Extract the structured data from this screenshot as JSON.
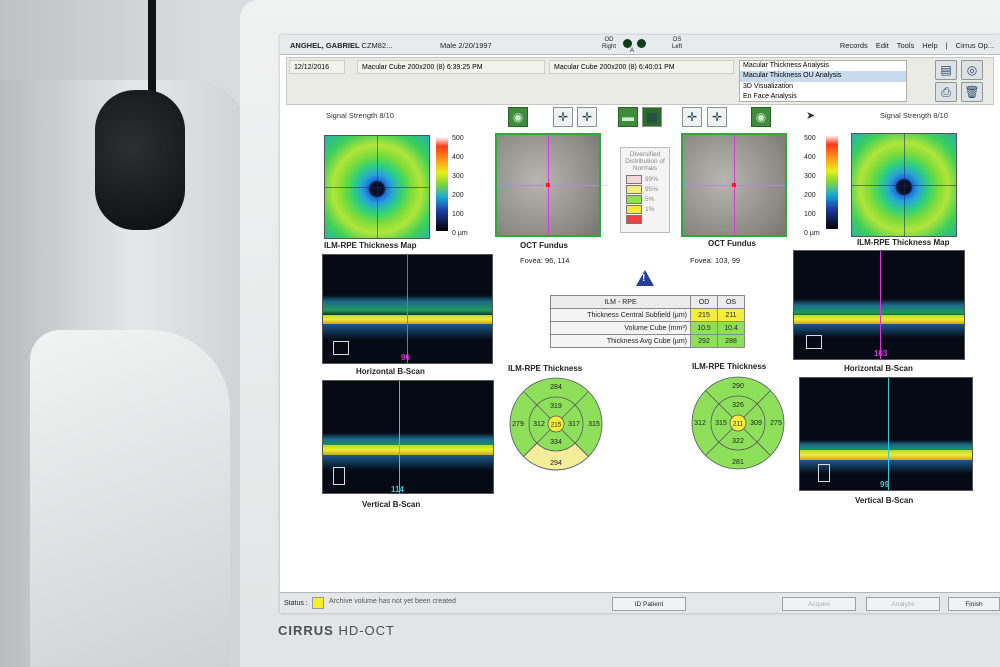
{
  "device": {
    "brand_bold": "CIRRUS",
    "brand_rest": " HD-OCT"
  },
  "titlebar": {
    "patient": "ANGHEL, GABRIEL",
    "patient_id": "CZM82...",
    "sex_dob": "Male  2/20/1997",
    "od_label": "OD",
    "od_sub": "Right",
    "a_label": "A",
    "os_label": "OS",
    "os_sub": "Left",
    "menu": [
      "Records",
      "Edit",
      "Tools",
      "Help",
      "|",
      "Cirrus Op..."
    ]
  },
  "exam_bar": {
    "date": "12/12/2016",
    "scan_od": "Macular Cube 200x200 (8) 6:39:25 PM",
    "scan_os": "Macular Cube 200x200 (8) 6:40:01 PM",
    "analyses": [
      "Macular Thickness Analysis",
      "Macular Thickness OU Analysis",
      "3D Visualization",
      "En Face Analysis"
    ],
    "selected_analysis": 1
  },
  "left_eye_panel": {
    "signal": "Signal Strength 8/10",
    "map_label": "ILM-RPE Thickness Map",
    "fundus_label": "OCT Fundus",
    "fovea": "Fovea:  96, 114",
    "hscan_label": "Horizontal B-Scan",
    "hscan_num": "96",
    "vscan_label": "Vertical B-Scan",
    "vscan_num": "114",
    "etdrs_title": "ILM-RPE Thickness",
    "etdrs": {
      "outer_top": "284",
      "outer_left": "279",
      "outer_right": "315",
      "outer_bottom": "294",
      "inner_top": "319",
      "inner_left": "312",
      "inner_right": "317",
      "inner_bottom": "334",
      "center": "215"
    }
  },
  "right_eye_panel": {
    "signal": "Signal Strength 8/10",
    "map_label": "ILM-RPE Thickness Map",
    "fundus_label": "OCT Fundus",
    "fovea": "Fovea:  103, 99",
    "hscan_label": "Horizontal B-Scan",
    "hscan_num": "103",
    "vscan_label": "Vertical B-Scan",
    "vscan_num": "99",
    "etdrs_title": "ILM-RPE Thickness",
    "etdrs": {
      "outer_top": "290",
      "outer_left": "312",
      "outer_right": "275",
      "outer_bottom": "281",
      "inner_top": "326",
      "inner_left": "315",
      "inner_right": "309",
      "inner_bottom": "322",
      "center": "211"
    }
  },
  "colorbar": {
    "ticks": [
      "500",
      "400",
      "300",
      "200",
      "100",
      "0 µm"
    ]
  },
  "normals": {
    "title": "Diversified Distribution of Normals",
    "rows": [
      {
        "label": "99%",
        "color": "#f4d6d6"
      },
      {
        "label": "95%",
        "color": "#f0f07a"
      },
      {
        "label": "5%",
        "color": "#8ee05a"
      },
      {
        "label": "1%",
        "color": "#f2e93a"
      },
      {
        "label": "",
        "color": "#ee4444"
      }
    ]
  },
  "ilm_table": {
    "header": [
      "ILM - RPE",
      "OD",
      "OS"
    ],
    "rows": [
      {
        "name": "Thickness Central Subfield (µm)",
        "od": "215",
        "os": "211",
        "od_color": "#f4ee3a",
        "os_color": "#f4ee3a"
      },
      {
        "name": "Volume Cube (mm³)",
        "od": "10.5",
        "os": "10.4",
        "od_color": "#8ee05a",
        "os_color": "#8ee05a"
      },
      {
        "name": "Thickness Avg Cube (µm)",
        "od": "292",
        "os": "288",
        "od_color": "#8ee05a",
        "os_color": "#8ee05a"
      }
    ]
  },
  "status": {
    "label": "Status :",
    "message": "Archive volume has not yet been created",
    "buttons": {
      "id_patient": "ID Patient",
      "acquire": "Acquire",
      "analyze": "Analyze",
      "finish": "Finish"
    }
  },
  "colors": {
    "normal_green": "#8ee05a",
    "borderline_yellow": "#f4ee3a",
    "cursor_magenta": "#d83ad8",
    "cursor_cyan": "#3ac8d8"
  }
}
